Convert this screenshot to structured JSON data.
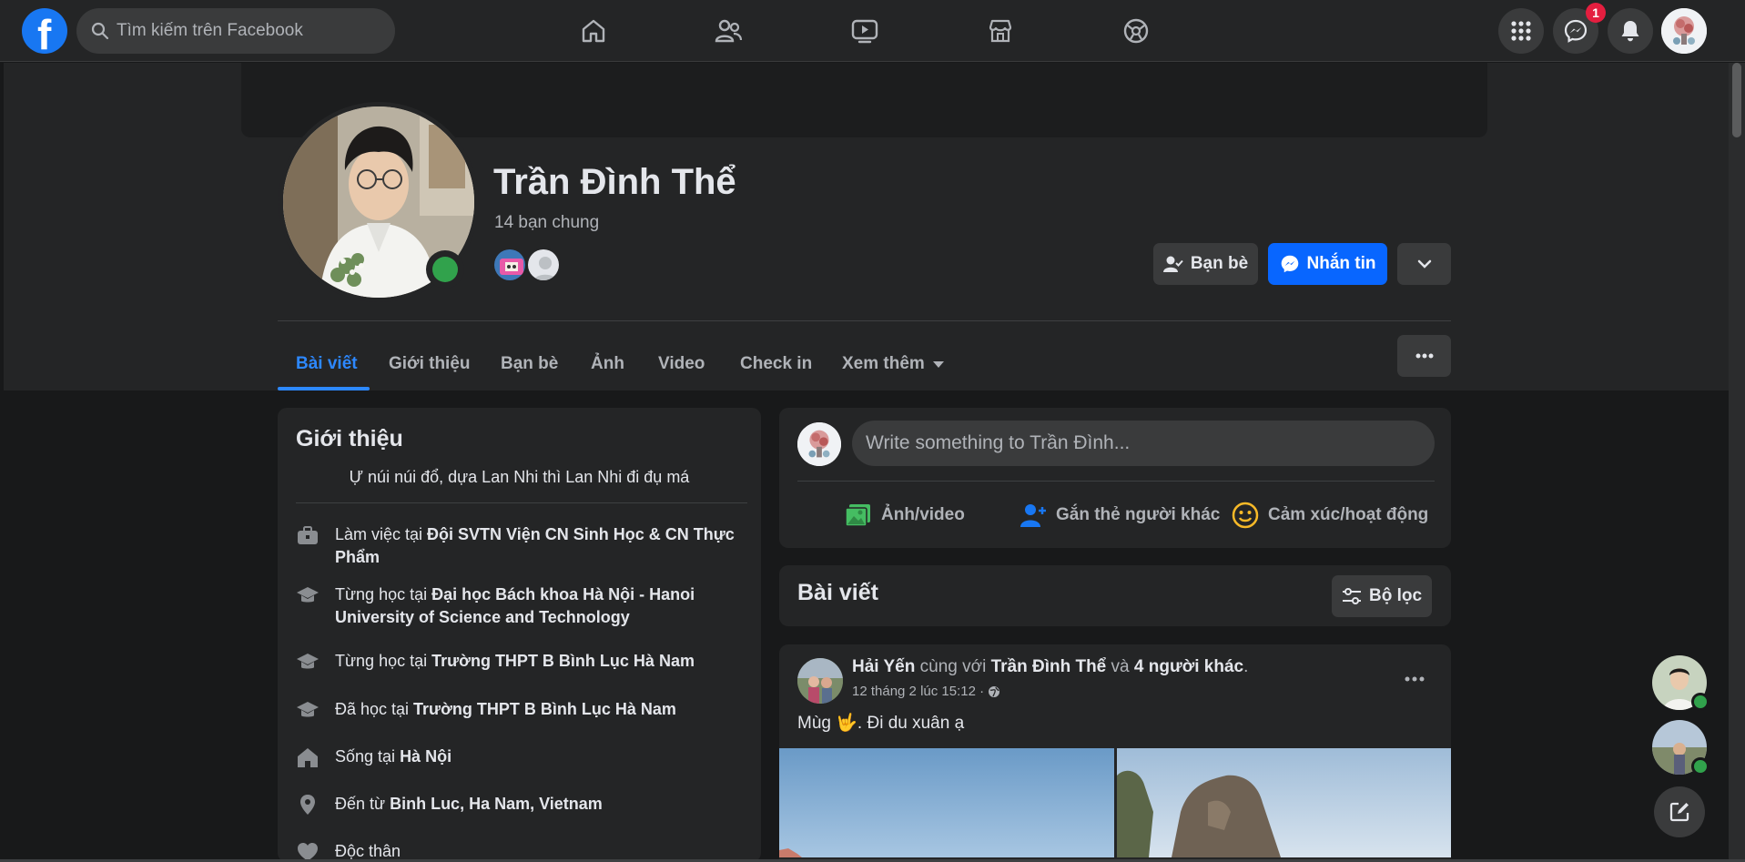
{
  "topbar": {
    "logo_letter": "f",
    "search_placeholder": "Tìm kiếm trên Facebook",
    "nav_icons": [
      "home-icon",
      "friends-icon",
      "watch-icon",
      "marketplace-icon",
      "gaming-icon"
    ],
    "right_icons": [
      "menu-grid-icon",
      "messenger-icon",
      "notifications-icon"
    ],
    "messenger_badge": "1"
  },
  "profile": {
    "name": "Trần Đình Thể",
    "mutual_friends": "14 bạn chung",
    "buttons": {
      "friends": "Bạn bè",
      "message": "Nhắn tin"
    }
  },
  "tabs": [
    "Bài viết",
    "Giới thiệu",
    "Bạn bè",
    "Ảnh",
    "Video",
    "Check in",
    "Xem thêm"
  ],
  "intro": {
    "title": "Giới thiệu",
    "bio": "Ự núi núi đổ, dựa Lan Nhi thì Lan Nhi đi đụ má",
    "items": [
      {
        "icon": "work-icon",
        "prefix": "Làm việc tại ",
        "value": "Đội SVTN Viện CN Sinh Học & CN Thực Phẩm"
      },
      {
        "icon": "education-icon",
        "prefix": "Từng học tại ",
        "value": "Đại học Bách khoa Hà Nội - Hanoi University of Science and Technology"
      },
      {
        "icon": "education-icon",
        "prefix": "Từng học tại ",
        "value": "Trường THPT B Bình Lục Hà Nam"
      },
      {
        "icon": "education-icon",
        "prefix": "Đã học tại ",
        "value": "Trường THPT B Bình Lục Hà Nam"
      },
      {
        "icon": "home-icon",
        "prefix": "Sống tại ",
        "value": "Hà Nội"
      },
      {
        "icon": "location-icon",
        "prefix": "Đến từ ",
        "value": "Binh Luc, Ha Nam, Vietnam"
      },
      {
        "icon": "heart-icon",
        "prefix": "",
        "value": "Độc thân"
      }
    ]
  },
  "composer": {
    "placeholder": "Write something to Trần Đình...",
    "actions": [
      "Ảnh/video",
      "Gắn thẻ người khác",
      "Cảm xúc/hoạt động"
    ]
  },
  "posts_section": {
    "title": "Bài viết",
    "filter_label": "Bộ lọc"
  },
  "post": {
    "author": "Hải Yến",
    "with_text": " cùng với ",
    "tagged": "Trần Đình Thể",
    "and_text": " và ",
    "others": "4 người khác",
    "time": "12 tháng 2 lúc 15:12 ·",
    "text_before": "Mùg ",
    "emoji": "🤟",
    "text_after": ". Đi du xuân ạ"
  },
  "colors": {
    "accent": "#2d88ff",
    "button_blue": "#0866ff",
    "online": "#31a24c",
    "badge": "#e41e3f"
  }
}
